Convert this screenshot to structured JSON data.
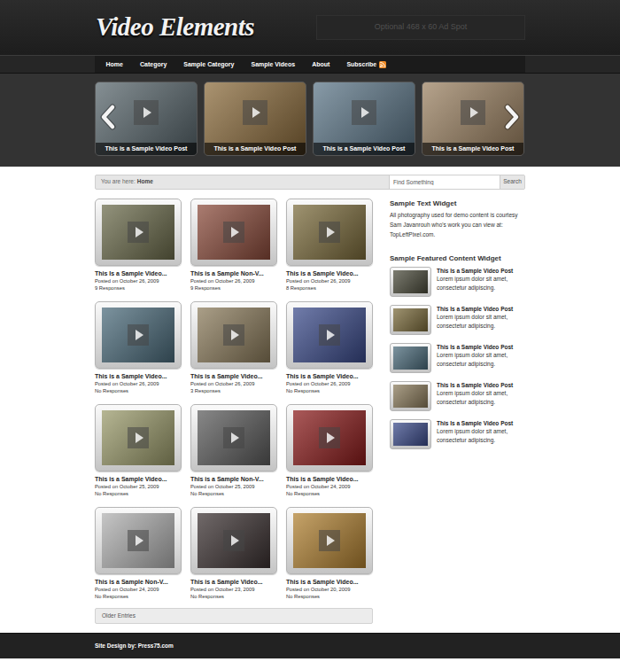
{
  "header": {
    "logo": "Video Elements",
    "ad": "Optional 468 x 60 Ad Spot"
  },
  "nav": {
    "items": [
      {
        "label": "Home",
        "kind": "link"
      },
      {
        "label": "Category",
        "kind": "link"
      },
      {
        "label": "Sample Category",
        "kind": "link"
      },
      {
        "label": "Sample Videos",
        "kind": "link"
      },
      {
        "label": "About",
        "kind": "link"
      },
      {
        "label": "Subscribe",
        "kind": "feed"
      }
    ]
  },
  "slider": {
    "items": [
      {
        "caption": "This is a Sample Video Post",
        "color": "#56646a"
      },
      {
        "caption": "This is a Sample Video Post",
        "color": "#8a6a3a"
      },
      {
        "caption": "This is a Sample Video Post",
        "color": "#5a7486"
      },
      {
        "caption": "This is a Sample Video Post",
        "color": "#9a8060"
      }
    ]
  },
  "breadcrumb": {
    "label": "You are here:",
    "current": "Home"
  },
  "search": {
    "placeholder": "Find Something",
    "button": "Search"
  },
  "posts": [
    {
      "title": "This Is a Sample Video...",
      "date": "Posted on October 26, 2009",
      "responses": "9 Responses",
      "color": "#6a6a4a"
    },
    {
      "title": "This is a Sample Non-V...",
      "date": "Posted on October 26, 2009",
      "responses": "9 Responses",
      "color": "#8a4a3a"
    },
    {
      "title": "This is a Sample Video...",
      "date": "Posted on October 26, 2009",
      "responses": "8 Responses",
      "color": "#7a6a3a"
    },
    {
      "title": "This is a Sample Video...",
      "date": "Posted on October 26, 2009",
      "responses": "No Responses",
      "color": "#4a6a7a"
    },
    {
      "title": "This is a Sample Video...",
      "date": "Posted on October 26, 2009",
      "responses": "3 Responses",
      "color": "#8a7a5a"
    },
    {
      "title": "This is a Sample Video...",
      "date": "Posted on October 26, 2009",
      "responses": "No Responses",
      "color": "#3a4a8a"
    },
    {
      "title": "This is a Sample Video...",
      "date": "Posted on October 25, 2009",
      "responses": "No Responses",
      "color": "#9a9a6a"
    },
    {
      "title": "This is a Sample Non-V...",
      "date": "Posted on October 25, 2009",
      "responses": "No Responses",
      "color": "#5a5a5a"
    },
    {
      "title": "This is a Sample Video...",
      "date": "Posted on October 24, 2009",
      "responses": "No Responses",
      "color": "#8a1a1a"
    },
    {
      "title": "This is a Sample Non-V...",
      "date": "Posted on October 24, 2009",
      "responses": "No Responses",
      "color": "#b0b0b0"
    },
    {
      "title": "This is a Sample Video...",
      "date": "Posted on October 23, 2009",
      "responses": "No Responses",
      "color": "#3a3030"
    },
    {
      "title": "This is a Sample Video...",
      "date": "Posted on October 20, 2009",
      "responses": "No Responses",
      "color": "#b08030"
    }
  ],
  "pagination": {
    "older": "Older Entries"
  },
  "sidebar": {
    "text_widget": {
      "title": "Sample Text Widget",
      "body": "All photography used for demo content is courtesy Sam Javanrouh who's work you can view at: TopLeftPixel.com."
    },
    "featured": {
      "title": "Sample Featured Content Widget",
      "items": [
        {
          "title": "This Is a Sample Video Post",
          "excerpt": "Lorem ipsum dolor sit amet, consectetur adipiscing.",
          "color": "#4a4a3a"
        },
        {
          "title": "This Is a Sample Video Post",
          "excerpt": "Lorem ipsum dolor sit amet, consectetur adipiscing.",
          "color": "#7a6a3a"
        },
        {
          "title": "This Is a Sample Video Post",
          "excerpt": "Lorem ipsum dolor sit amet, consectetur adipiscing.",
          "color": "#4a6a7a"
        },
        {
          "title": "This Is a Sample Video Post",
          "excerpt": "Lorem ipsum dolor sit amet, consectetur adipiscing.",
          "color": "#8a7a5a"
        },
        {
          "title": "This Is a Sample Video Post",
          "excerpt": "Lorem ipsum dolor sit amet, consectetur adipiscing.",
          "color": "#3a4a8a"
        }
      ]
    }
  },
  "footer": {
    "credit": "Site Design by: Press75.com"
  }
}
